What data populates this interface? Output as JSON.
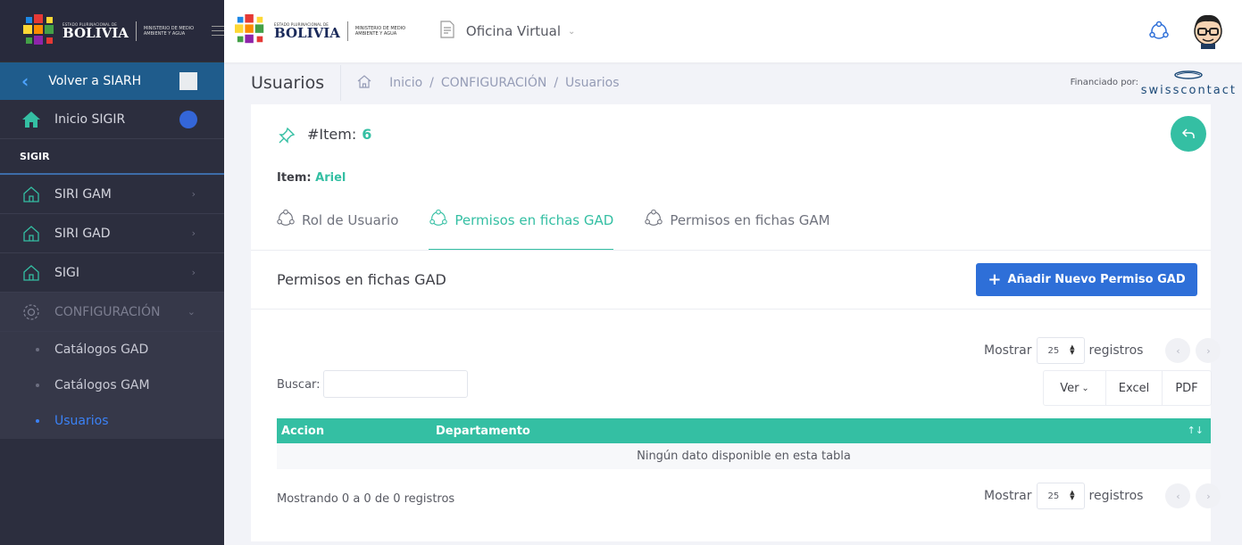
{
  "sidebar": {
    "logo": {
      "small": "ESTADO PLURINACIONAL DE",
      "big": "BOLIVIA",
      "ministry": "MINISTERIO DE MEDIO AMBIENTE Y AGUA"
    },
    "back_label": "Volver a SIARH",
    "home_label": "Inicio SIGIR",
    "section_label": "SIGIR",
    "items": [
      {
        "label": "SIRI GAM"
      },
      {
        "label": "SIRI GAD"
      },
      {
        "label": "SIGI"
      }
    ],
    "config_label": "CONFIGURACIÓN",
    "sub_items": [
      {
        "label": "Catálogos GAD"
      },
      {
        "label": "Catálogos GAM"
      },
      {
        "label": "Usuarios"
      }
    ]
  },
  "topbar": {
    "logo": {
      "small": "ESTADO PLURINACIONAL DE",
      "big": "BOLIVIA",
      "ministry": "MINISTERIO DE MEDIO AMBIENTE Y AGUA"
    },
    "office_label": "Oficina Virtual"
  },
  "subheader": {
    "title": "Usuarios",
    "breadcrumbs": [
      "Inicio",
      "/",
      "CONFIGURACIÓN",
      "/",
      "Usuarios"
    ],
    "financed_label": "Financiado por:",
    "sponsor": "swisscontact"
  },
  "card": {
    "item_label": "#Item:",
    "item_number": "6",
    "item_name_label": "Item:",
    "item_name": "Ariel",
    "tabs": [
      {
        "label": "Rol de Usuario"
      },
      {
        "label": "Permisos en fichas GAD"
      },
      {
        "label": "Permisos en fichas GAM"
      }
    ],
    "section_title": "Permisos en fichas GAD",
    "add_button": "Añadir Nuevo Permiso GAD",
    "show_label": "Mostrar",
    "page_length": "25",
    "records_label": "registros",
    "search_label": "Buscar:",
    "search_value": "",
    "export_buttons": {
      "view": "Ver",
      "excel": "Excel",
      "pdf": "PDF"
    },
    "table": {
      "columns": [
        "Accion",
        "Departamento"
      ],
      "empty_message": "Ningún dato disponible en esta tabla"
    },
    "info": "Mostrando 0 a 0 de 0 registros"
  },
  "colors": {
    "accent": "#34bfa3",
    "primary": "#2e6fd8",
    "sidebar": "#2c2e3e",
    "back_bar": "#1f5c8c"
  }
}
